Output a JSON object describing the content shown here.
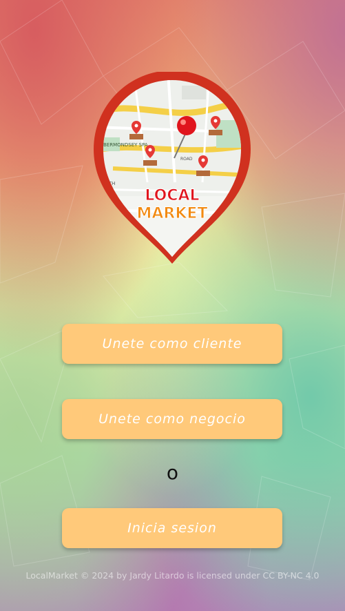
{
  "logo": {
    "line1": "LOCAL",
    "line2": "MARKET"
  },
  "buttons": {
    "client": "Unete como cliente",
    "business": "Unete como negocio",
    "login": "Inicia sesion"
  },
  "separator": "o",
  "footer": "LocalMarket © 2024 by Jardy Litardo is licensed under CC BY-NC 4.0",
  "map_labels": {
    "area": "BERMONDSEY SPA",
    "street": "ORTH",
    "road": "ROAD"
  },
  "colors": {
    "button": "#ffc97a",
    "logo_border": "#d0311f",
    "logo_text_red": "#e0151d",
    "logo_text_orange": "#f28a12"
  }
}
